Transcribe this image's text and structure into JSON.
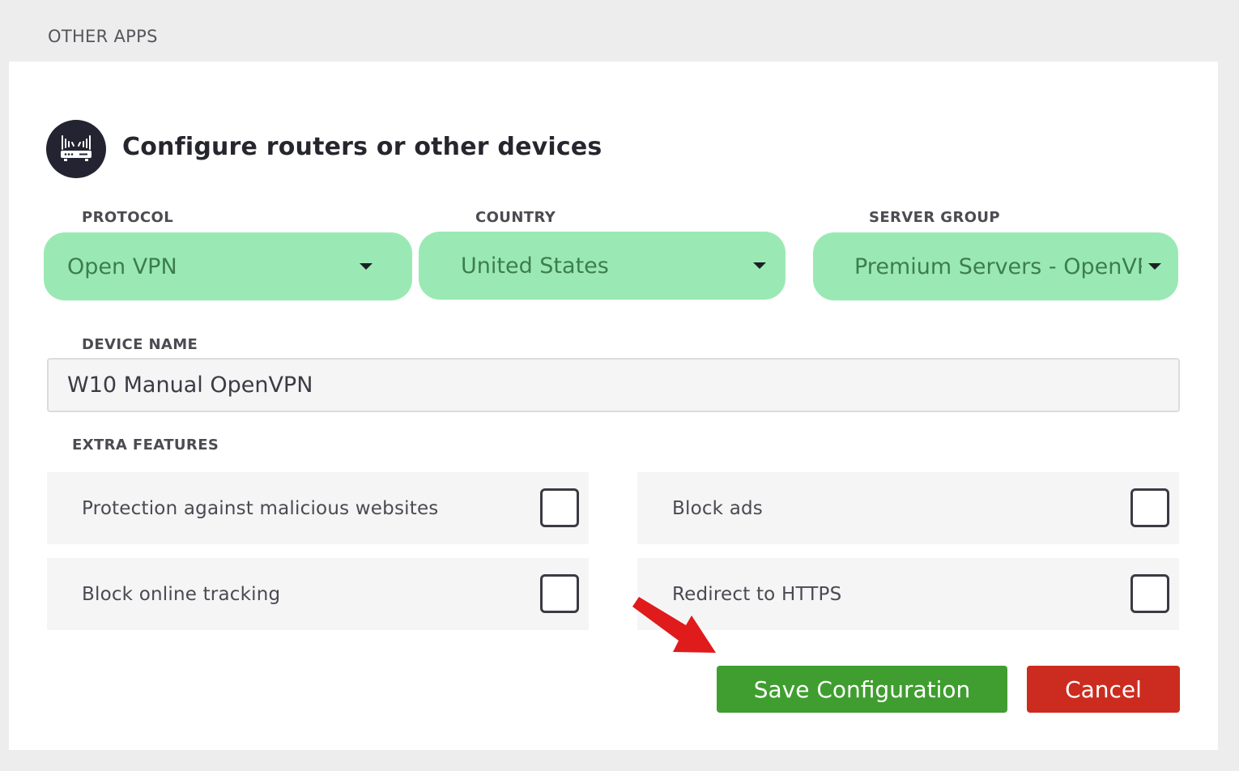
{
  "page": {
    "section_heading": "OTHER APPS"
  },
  "card": {
    "title": "Configure routers or other devices",
    "icon": "router-icon"
  },
  "form": {
    "protocol": {
      "label": "PROTOCOL",
      "value": "Open VPN"
    },
    "country": {
      "label": "COUNTRY",
      "value": "United States"
    },
    "server_group": {
      "label": "SERVER GROUP",
      "value": "Premium Servers - OpenVPN"
    },
    "device_name": {
      "label": "DEVICE NAME",
      "value": "W10 Manual OpenVPN"
    }
  },
  "extra_features": {
    "label": "EXTRA FEATURES",
    "items": [
      {
        "label": "Protection against malicious websites",
        "checked": false
      },
      {
        "label": "Block ads",
        "checked": false
      },
      {
        "label": "Block online tracking",
        "checked": false
      },
      {
        "label": "Redirect to HTTPS",
        "checked": false
      }
    ]
  },
  "actions": {
    "save_label": "Save Configuration",
    "cancel_label": "Cancel"
  },
  "colors": {
    "select_bg": "#9ae9b4",
    "select_text": "#3d7c51",
    "save_button": "#3f9e2f",
    "cancel_button": "#cc2c1f",
    "annotation_arrow": "#e01b1b",
    "icon_badge": "#232331"
  }
}
